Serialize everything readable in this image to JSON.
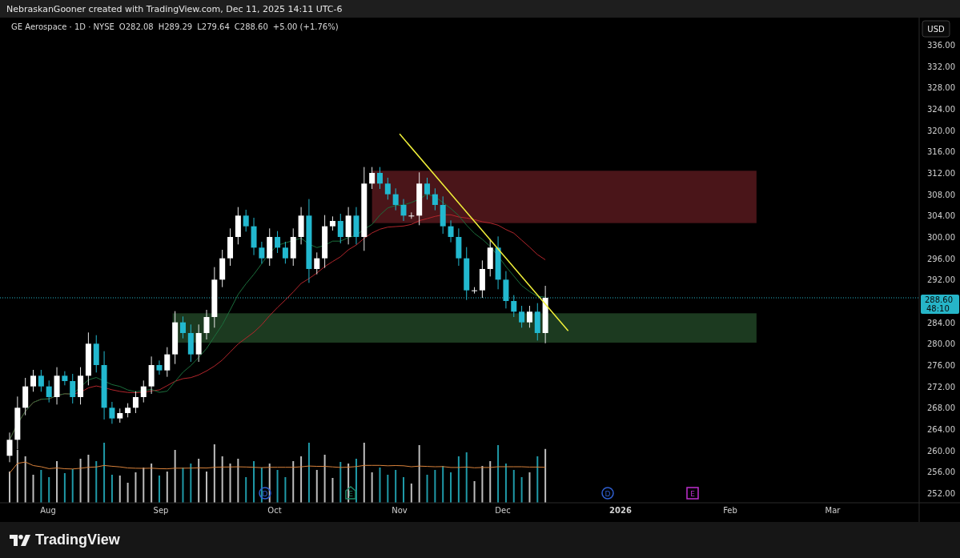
{
  "top_bar": {
    "text": "NebraskanGooner created with TradingView.com, Dec 11, 2025 14:11 UTC-6"
  },
  "legend": {
    "symbol": "GE Aerospace · 1D · NYSE",
    "values": [
      {
        "label": "O",
        "value": "282.08"
      },
      {
        "label": "H",
        "value": "289.29"
      },
      {
        "label": "L",
        "value": "279.64"
      },
      {
        "label": "C",
        "value": "288.60"
      }
    ],
    "change": "+5.00 (+1.76%)"
  },
  "currency_button": "USD",
  "price_axis": [
    "336.00",
    "332.00",
    "328.00",
    "324.00",
    "320.00",
    "316.00",
    "312.00",
    "308.00",
    "304.00",
    "300.00",
    "296.00",
    "292.00",
    "284.00",
    "280.00",
    "276.00",
    "272.00",
    "268.00",
    "264.00",
    "260.00",
    "256.00",
    "252.00"
  ],
  "price_tag": {
    "price": "288.60",
    "countdown": "48:10"
  },
  "time_axis": [
    {
      "label": "Aug",
      "kind": "month"
    },
    {
      "label": "Sep",
      "kind": "month"
    },
    {
      "label": "Oct",
      "kind": "month"
    },
    {
      "label": "Nov",
      "kind": "month"
    },
    {
      "label": "Dec",
      "kind": "month"
    },
    {
      "label": "2026",
      "kind": "year"
    },
    {
      "label": "Feb",
      "kind": "month"
    },
    {
      "label": "Mar",
      "kind": "month"
    }
  ],
  "events": [
    {
      "kind": "dividend",
      "label": "D"
    },
    {
      "kind": "earnings",
      "label": "E"
    },
    {
      "kind": "dividend",
      "label": "D"
    },
    {
      "kind": "earnings_future",
      "label": "E"
    }
  ],
  "footer": {
    "brand": "TradingView"
  }
}
